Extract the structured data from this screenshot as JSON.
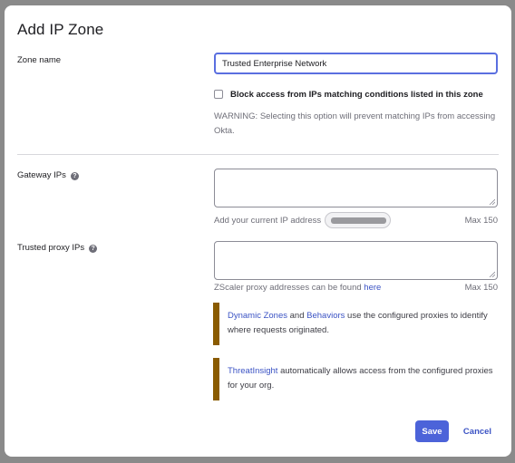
{
  "dialog": {
    "title": "Add IP Zone"
  },
  "zone_name": {
    "label": "Zone name",
    "value": "Trusted Enterprise Network"
  },
  "block_access": {
    "label": "Block access from IPs matching conditions listed in this zone",
    "checked": false,
    "warning": "WARNING: Selecting this option will prevent matching IPs from accessing Okta."
  },
  "gateway_ips": {
    "label": "Gateway IPs",
    "help_icon": "?",
    "value": "",
    "helper_text": "Add your current IP address",
    "current_ip": "[redacted]",
    "max_text": "Max 150"
  },
  "trusted_proxy_ips": {
    "label": "Trusted proxy IPs",
    "help_icon": "?",
    "value": "",
    "helper_prefix": "ZScaler proxy addresses can be found ",
    "helper_link": "here",
    "max_text": "Max 150"
  },
  "callouts": [
    {
      "link1": "Dynamic Zones",
      "text1": " and ",
      "link2": "Behaviors",
      "text2": " use the configured proxies to identify where requests originated."
    },
    {
      "link1": "ThreatInsight",
      "text1": " automatically allows access from the configured proxies for your org."
    }
  ],
  "actions": {
    "save_label": "Save",
    "cancel_label": "Cancel"
  },
  "colors": {
    "primary": "#4c63d9",
    "link": "#3b53c4",
    "callout_accent": "#8a5b00",
    "focus_border": "#5a6fe0"
  }
}
